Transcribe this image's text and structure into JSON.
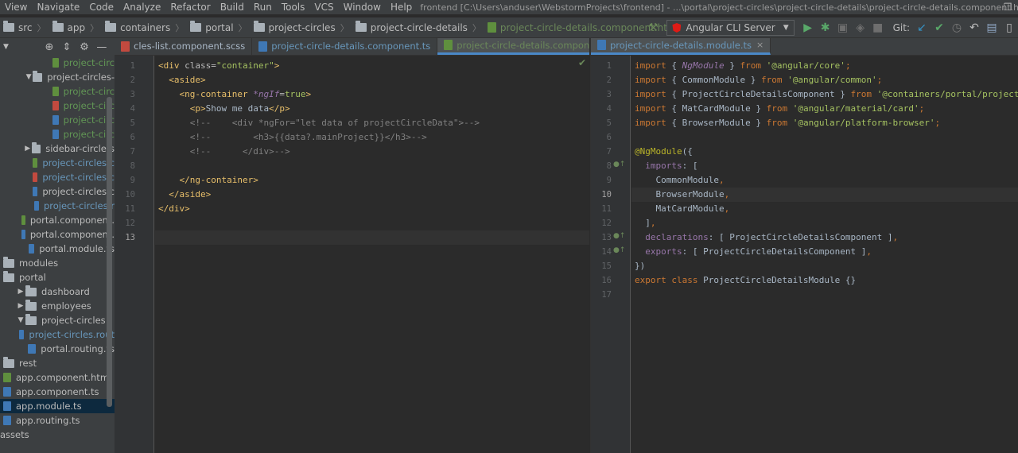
{
  "menu": [
    "View",
    "Navigate",
    "Code",
    "Analyze",
    "Refactor",
    "Build",
    "Run",
    "Tools",
    "VCS",
    "Window",
    "Help"
  ],
  "window_title": "frontend [C:\\Users\\anduser\\WebstormProjects\\frontend] - ...\\portal\\project-circles\\project-circle-details\\project-circle-details.component.html",
  "breadcrumb": [
    "src",
    "app",
    "containers",
    "portal",
    "project-circles",
    "project-circle-details",
    "project-circle-details.component.html"
  ],
  "toolbar": {
    "run_config": "Angular CLI Server",
    "git_label": "Git:"
  },
  "left_tabs": [
    {
      "label": "cles-list.component.scss",
      "kind": "css"
    },
    {
      "label": "project-circle-details.component.ts",
      "kind": "ts"
    },
    {
      "label": "project-circle-details.component.html",
      "kind": "html"
    }
  ],
  "right_tabs": [
    {
      "label": "project-circle-details.module.ts",
      "kind": "ts"
    }
  ],
  "tree": [
    {
      "label": "project-circ",
      "indent": 5,
      "icon": "html",
      "color": "green"
    },
    {
      "label": "project-circles-",
      "indent": 2,
      "icon": "folder",
      "arrow": "down"
    },
    {
      "label": "project-circ",
      "indent": 5,
      "icon": "html",
      "color": "green"
    },
    {
      "label": "project-circ",
      "indent": 5,
      "icon": "css",
      "color": "green"
    },
    {
      "label": "project-circ",
      "indent": 5,
      "icon": "ts",
      "color": "green"
    },
    {
      "label": "project-circ",
      "indent": 5,
      "icon": "ts",
      "color": "green"
    },
    {
      "label": "sidebar-circle-s",
      "indent": 2,
      "icon": "folder",
      "arrow": "right"
    },
    {
      "label": "project-circles.c",
      "indent": 4,
      "icon": "html",
      "color": "blue"
    },
    {
      "label": "project-circles.c",
      "indent": 4,
      "icon": "css",
      "color": "blue"
    },
    {
      "label": "project-circles.c",
      "indent": 4,
      "icon": "ts",
      "color": "plain"
    },
    {
      "label": "project-circles.r",
      "indent": 4,
      "icon": "ts",
      "color": "blue"
    },
    {
      "label": "portal.component.",
      "indent": 3,
      "icon": "html",
      "color": "plain"
    },
    {
      "label": "portal.component.",
      "indent": 3,
      "icon": "ts",
      "color": "plain"
    },
    {
      "label": "portal.module.ts",
      "indent": 3,
      "icon": "ts",
      "color": "plain"
    },
    {
      "label": "modules",
      "indent": 0,
      "icon": "folder",
      "color": "plain"
    },
    {
      "label": "portal",
      "indent": 0,
      "icon": "folder",
      "color": "plain"
    },
    {
      "label": "dashboard",
      "indent": 1,
      "icon": "folder",
      "arrow": "right"
    },
    {
      "label": "employees",
      "indent": 1,
      "icon": "folder",
      "arrow": "right"
    },
    {
      "label": "project-circles",
      "indent": 1,
      "icon": "folder",
      "arrow": "down"
    },
    {
      "label": "project-circles.rout",
      "indent": 2,
      "icon": "ts",
      "color": "blue"
    },
    {
      "label": "portal.routing.ts",
      "indent": 2,
      "icon": "ts",
      "color": "plain"
    },
    {
      "label": "rest",
      "indent": 0,
      "icon": "folder",
      "color": "plain"
    },
    {
      "label": "app.component.html",
      "indent": 0,
      "icon": "html",
      "color": "plain"
    },
    {
      "label": "app.component.ts",
      "indent": 0,
      "icon": "ts",
      "color": "plain"
    },
    {
      "label": "app.module.ts",
      "indent": 0,
      "icon": "ts",
      "color": "plain",
      "selected": true
    },
    {
      "label": "app.routing.ts",
      "indent": 0,
      "icon": "ts",
      "color": "plain"
    },
    {
      "label": "assets",
      "indent": -1,
      "icon": "none",
      "color": "plain"
    }
  ],
  "html_code": [
    [
      {
        "t": "<div ",
        "c": "tag"
      },
      {
        "t": "class=",
        "c": "attr"
      },
      {
        "t": "\"container\"",
        "c": "str"
      },
      {
        "t": ">",
        "c": "tag"
      }
    ],
    [
      {
        "t": "  <aside>",
        "c": "tag"
      }
    ],
    [
      {
        "t": "    <ng-container ",
        "c": "tag"
      },
      {
        "t": "*ngIf",
        "c": "ngif"
      },
      {
        "t": "=",
        "c": "attr"
      },
      {
        "t": "true",
        "c": "str"
      },
      {
        "t": ">",
        "c": "tag"
      }
    ],
    [
      {
        "t": "      <p>",
        "c": "tag"
      },
      {
        "t": "Show me data",
        "c": "text"
      },
      {
        "t": "</p>",
        "c": "tag"
      }
    ],
    [
      {
        "t": "      <!--    <div *ngFor=\"let data of projectCircleData\">-->",
        "c": "com"
      }
    ],
    [
      {
        "t": "      <!--        <h3>{{data?.mainProject}}</h3>-->",
        "c": "com"
      }
    ],
    [
      {
        "t": "      <!--      </div>-->",
        "c": "com"
      }
    ],
    [
      {
        "t": "",
        "c": "text"
      }
    ],
    [
      {
        "t": "    </ng-container>",
        "c": "tag"
      }
    ],
    [
      {
        "t": "  </aside>",
        "c": "tag"
      }
    ],
    [
      {
        "t": "</div>",
        "c": "tag"
      }
    ],
    [
      {
        "t": "",
        "c": "text"
      }
    ],
    [
      {
        "t": "",
        "c": "text"
      }
    ]
  ],
  "ts_code": [
    [
      {
        "t": "import ",
        "c": "kw"
      },
      {
        "t": "{ ",
        "c": "plain"
      },
      {
        "t": "NgModule",
        "c": "purple"
      },
      {
        "t": " } ",
        "c": "plain"
      },
      {
        "t": "from ",
        "c": "kw"
      },
      {
        "t": "'@angular/core'",
        "c": "str"
      },
      {
        "t": ";",
        "c": "kw"
      }
    ],
    [
      {
        "t": "import ",
        "c": "kw"
      },
      {
        "t": "{ CommonModule } ",
        "c": "plain"
      },
      {
        "t": "from ",
        "c": "kw"
      },
      {
        "t": "'@angular/common'",
        "c": "str"
      },
      {
        "t": ";",
        "c": "kw"
      }
    ],
    [
      {
        "t": "import ",
        "c": "kw"
      },
      {
        "t": "{ ProjectCircleDetailsComponent } ",
        "c": "plain"
      },
      {
        "t": "from ",
        "c": "kw"
      },
      {
        "t": "'@containers/portal/project-",
        "c": "str"
      }
    ],
    [
      {
        "t": "import ",
        "c": "kw"
      },
      {
        "t": "{ MatCardModule } ",
        "c": "plain"
      },
      {
        "t": "from ",
        "c": "kw"
      },
      {
        "t": "'@angular/material/card'",
        "c": "str"
      },
      {
        "t": ";",
        "c": "kw"
      }
    ],
    [
      {
        "t": "import ",
        "c": "kw"
      },
      {
        "t": "{ BrowserModule } ",
        "c": "plain"
      },
      {
        "t": "from ",
        "c": "kw"
      },
      {
        "t": "'@angular/platform-browser'",
        "c": "str"
      },
      {
        "t": ";",
        "c": "kw"
      }
    ],
    [
      {
        "t": "",
        "c": "plain"
      }
    ],
    [
      {
        "t": "@NgModule",
        "c": "ann"
      },
      {
        "t": "({",
        "c": "plain"
      }
    ],
    [
      {
        "t": "  imports",
        "c": "purple2"
      },
      {
        "t": ": [",
        "c": "plain"
      }
    ],
    [
      {
        "t": "    CommonModule",
        "c": "plain"
      },
      {
        "t": ",",
        "c": "kw"
      }
    ],
    [
      {
        "t": "    BrowserModule",
        "c": "plain"
      },
      {
        "t": ",",
        "c": "kw"
      }
    ],
    [
      {
        "t": "    MatCardModule",
        "c": "plain"
      },
      {
        "t": ",",
        "c": "kw"
      }
    ],
    [
      {
        "t": "  ]",
        "c": "plain"
      },
      {
        "t": ",",
        "c": "kw"
      }
    ],
    [
      {
        "t": "  declarations",
        "c": "purple2"
      },
      {
        "t": ": [ ProjectCircleDetailsComponent ]",
        "c": "plain"
      },
      {
        "t": ",",
        "c": "kw"
      }
    ],
    [
      {
        "t": "  exports",
        "c": "purple2"
      },
      {
        "t": ": [ ProjectCircleDetailsComponent ]",
        "c": "plain"
      },
      {
        "t": ",",
        "c": "kw"
      }
    ],
    [
      {
        "t": "})",
        "c": "plain"
      }
    ],
    [
      {
        "t": "export class ",
        "c": "kw"
      },
      {
        "t": "ProjectCircleDetailsModule {}",
        "c": "plain"
      }
    ],
    [
      {
        "t": "",
        "c": "plain"
      }
    ]
  ],
  "html_current_line": 13,
  "ts_current_line": 10
}
